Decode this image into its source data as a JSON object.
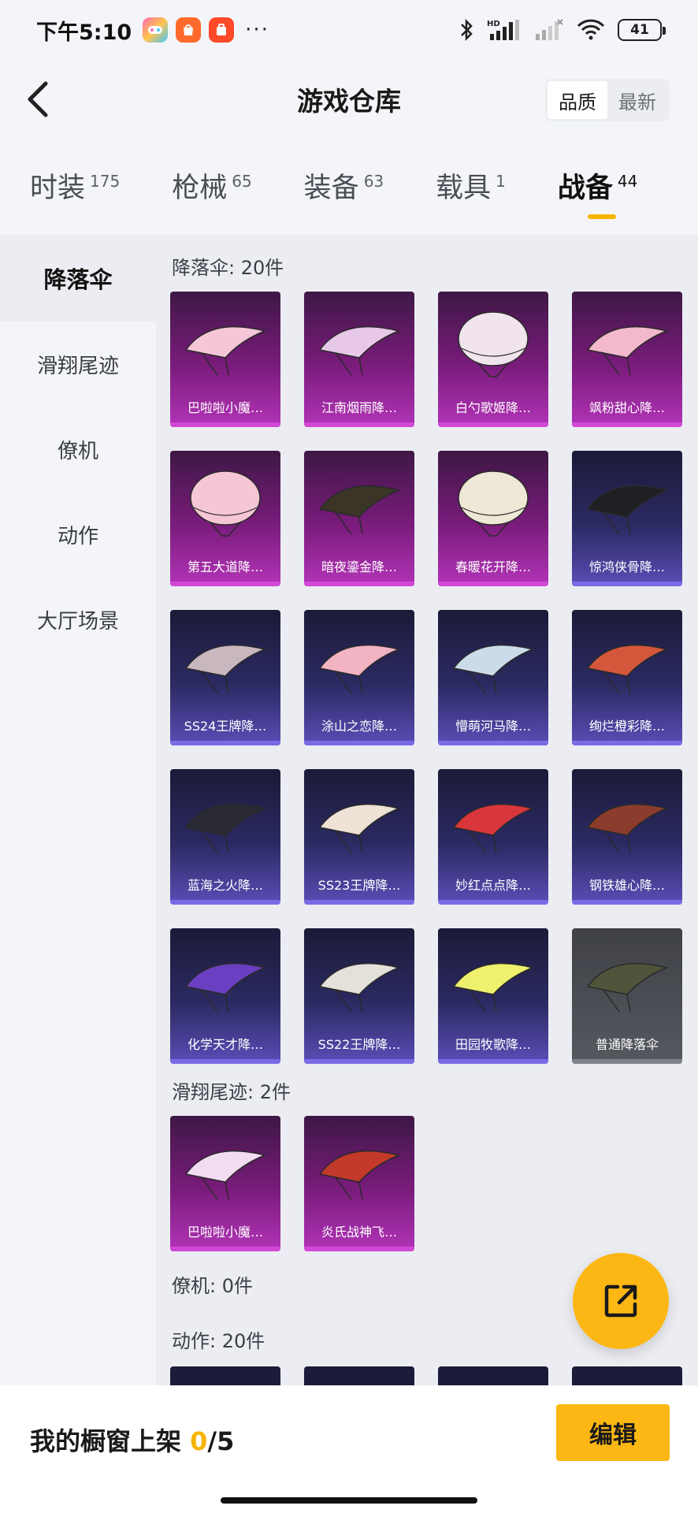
{
  "status_bar": {
    "time": "下午5:10",
    "more_dots": "···",
    "battery": "41",
    "hd_label": "HD"
  },
  "header": {
    "title": "游戏仓库",
    "sort_options": [
      {
        "label": "品质",
        "active": true
      },
      {
        "label": "最新",
        "active": false
      }
    ]
  },
  "category_tabs": [
    {
      "label": "时装",
      "count": "175",
      "active": false
    },
    {
      "label": "枪械",
      "count": "65",
      "active": false
    },
    {
      "label": "装备",
      "count": "63",
      "active": false
    },
    {
      "label": "载具",
      "count": "1",
      "active": false
    },
    {
      "label": "战备",
      "count": "44",
      "active": true
    }
  ],
  "sidebar": {
    "items": [
      {
        "label": "降落伞",
        "active": true
      },
      {
        "label": "滑翔尾迹",
        "active": false
      },
      {
        "label": "僚机",
        "active": false
      },
      {
        "label": "动作",
        "active": false
      },
      {
        "label": "大厅场景",
        "active": false
      }
    ]
  },
  "sections": {
    "parachutes": {
      "title": "降落伞: 20件",
      "items": [
        {
          "name": "巴啦啦小魔…",
          "rarity": "purple",
          "color": "#f4c6d8"
        },
        {
          "name": "江南烟雨降…",
          "rarity": "purple",
          "color": "#e7c8e8"
        },
        {
          "name": "白勺歌姬降…",
          "rarity": "purple",
          "color": "#f1e4ec"
        },
        {
          "name": "飒粉甜心降…",
          "rarity": "purple",
          "color": "#f3b8cc"
        },
        {
          "name": "第五大道降…",
          "rarity": "purple",
          "color": "#f5c6d4"
        },
        {
          "name": "暗夜鎏金降…",
          "rarity": "purple",
          "color": "#3b3527"
        },
        {
          "name": "春暖花开降…",
          "rarity": "purple",
          "color": "#efe8d7"
        },
        {
          "name": "惊鸿侠骨降…",
          "rarity": "blue",
          "color": "#1f1f24"
        },
        {
          "name": "SS24王牌降…",
          "rarity": "blue",
          "color": "#c9b7c0"
        },
        {
          "name": "涂山之恋降…",
          "rarity": "blue",
          "color": "#f2b3c2"
        },
        {
          "name": "懵萌河马降…",
          "rarity": "blue",
          "color": "#cbdbe9"
        },
        {
          "name": "绚烂橙彩降…",
          "rarity": "blue",
          "color": "#d4573c"
        },
        {
          "name": "蓝海之火降…",
          "rarity": "blue",
          "color": "#2a2a35"
        },
        {
          "name": "SS23王牌降…",
          "rarity": "blue",
          "color": "#eee2d6"
        },
        {
          "name": "妙红点点降…",
          "rarity": "blue",
          "color": "#d9363c"
        },
        {
          "name": "钢铁雄心降…",
          "rarity": "blue",
          "color": "#8c3c2c"
        },
        {
          "name": "化学天才降…",
          "rarity": "blue",
          "color": "#6a3fc2"
        },
        {
          "name": "SS22王牌降…",
          "rarity": "blue",
          "color": "#e4e0da"
        },
        {
          "name": "田园牧歌降…",
          "rarity": "blue",
          "color": "#eef06e"
        },
        {
          "name": "普通降落伞",
          "rarity": "gray",
          "color": "#4f553b"
        }
      ]
    },
    "glide_trails": {
      "title": "滑翔尾迹: 2件",
      "items": [
        {
          "name": "巴啦啦小魔…",
          "rarity": "purple",
          "color": "#f2dcf2"
        },
        {
          "name": "炎氏战神飞…",
          "rarity": "purple",
          "color": "#c43a2a"
        }
      ]
    },
    "wingman": {
      "title": "僚机: 0件"
    },
    "emotes": {
      "title": "动作: 20件"
    }
  },
  "bottom_bar": {
    "showcase_label": "我的橱窗上架 ",
    "showcase_current": "0",
    "showcase_total": "/5",
    "edit_label": "编辑"
  },
  "colors": {
    "accent": "#fdb714",
    "purple_rarity": "#b334b8",
    "blue_rarity": "#5a4eb8",
    "gray_rarity": "#55585e"
  }
}
